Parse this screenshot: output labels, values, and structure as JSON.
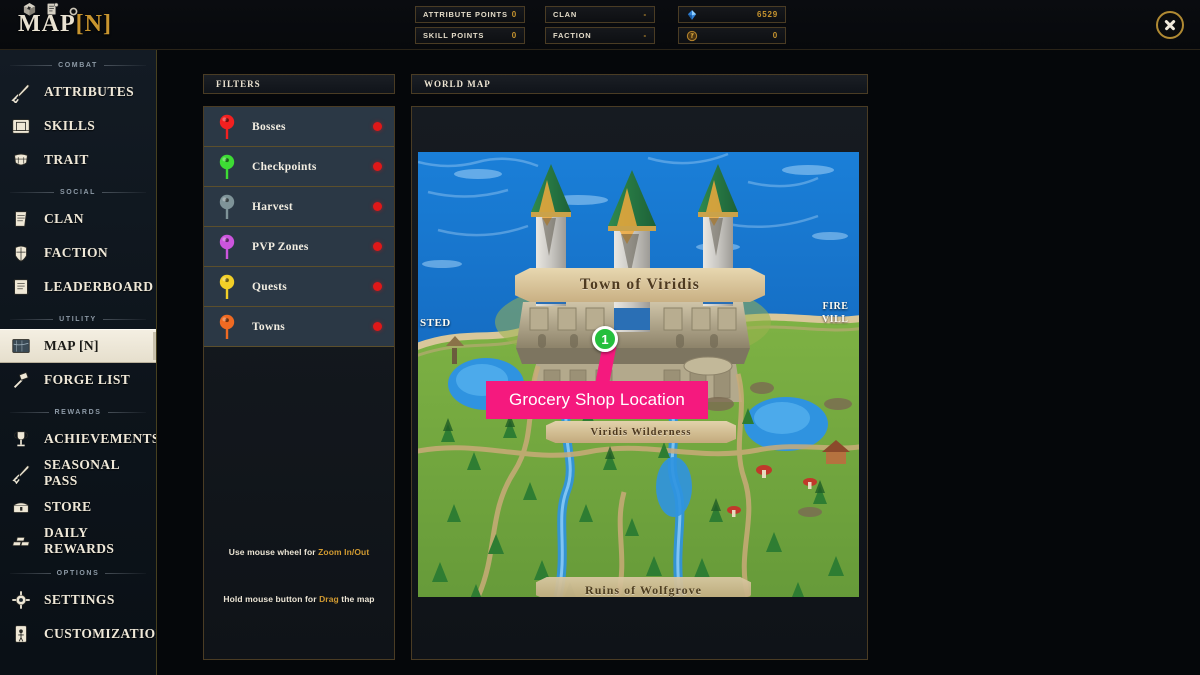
{
  "window": {
    "title": "MAP",
    "hotkey": "[N]",
    "close_label": "close"
  },
  "header": {
    "stats": [
      {
        "label": "ATTRIBUTE POINTS",
        "value": "0"
      },
      {
        "label": "SKILL POINTS",
        "value": "0"
      },
      {
        "label": "CLAN",
        "value": "-"
      },
      {
        "label": "FACTION",
        "value": "-"
      }
    ],
    "currencies": [
      {
        "icon": "gem-icon",
        "value": "6529",
        "color": "#2f7fd6"
      },
      {
        "icon": "coin-icon",
        "value": "0",
        "color": "#b3822c"
      }
    ]
  },
  "sidebar": {
    "sections": [
      {
        "title": "COMBAT",
        "items": [
          {
            "label": "ATTRIBUTES",
            "icon": "sword-icon",
            "active": false
          },
          {
            "label": "SKILLS",
            "icon": "book-icon",
            "active": false
          },
          {
            "label": "TRAIT",
            "icon": "armor-icon",
            "active": false
          }
        ]
      },
      {
        "title": "SOCIAL",
        "items": [
          {
            "label": "CLAN",
            "icon": "banner-icon",
            "active": false
          },
          {
            "label": "FACTION",
            "icon": "helmet-icon",
            "active": false
          },
          {
            "label": "LEADERBOARD",
            "icon": "scroll-icon",
            "active": false
          }
        ]
      },
      {
        "title": "UTILITY",
        "items": [
          {
            "label": "MAP [N]",
            "icon": "map-icon",
            "active": true
          },
          {
            "label": "FORGE LIST",
            "icon": "hammer-icon",
            "active": false
          }
        ]
      },
      {
        "title": "REWARDS",
        "items": [
          {
            "label": "ACHIEVEMENTS",
            "icon": "trophy-icon",
            "active": false
          },
          {
            "label": "SEASONAL PASS",
            "icon": "sword-pass-icon",
            "active": false
          },
          {
            "label": "STORE",
            "icon": "chest-icon",
            "active": false
          },
          {
            "label": "DAILY REWARDS",
            "icon": "gold-bars-icon",
            "active": false
          }
        ]
      },
      {
        "title": "OPTIONS",
        "items": [
          {
            "label": "SETTINGS",
            "icon": "gear-icon",
            "active": false
          },
          {
            "label": "CUSTOMIZATION",
            "icon": "character-card-icon",
            "active": false
          }
        ]
      }
    ]
  },
  "filters": {
    "panel_title": "FILTERS",
    "items": [
      {
        "label": "Bosses",
        "pin_color": "#f22020",
        "toggle_color": "#e01818"
      },
      {
        "label": "Checkpoints",
        "pin_color": "#3ddb34",
        "toggle_color": "#e01818"
      },
      {
        "label": "Harvest",
        "pin_color": "#7e9398",
        "toggle_color": "#e01818"
      },
      {
        "label": "PVP Zones",
        "pin_color": "#cc55dd",
        "toggle_color": "#e01818"
      },
      {
        "label": "Quests",
        "pin_color": "#f2cf27",
        "toggle_color": "#e01818"
      },
      {
        "label": "Towns",
        "pin_color": "#ef6a22",
        "toggle_color": "#e01818"
      }
    ],
    "hints": [
      {
        "prefix": "Use mouse wheel for ",
        "highlight": "Zoom In/Out",
        "suffix": ""
      },
      {
        "prefix": "Hold mouse button for ",
        "highlight": "Drag",
        "suffix": " the map"
      }
    ]
  },
  "map": {
    "panel_title": "WORLD MAP",
    "banners": {
      "town": "Town of Viridis",
      "wilderness": "Viridis Wilderness",
      "bottom": "Ruins of Wolfgrove"
    },
    "edge_labels": {
      "left": "STED",
      "right": "FIRE\nVILL"
    },
    "annotation": {
      "badge_number": "1",
      "tooltip_text": "Grocery Shop Location",
      "tooltip_color": "#f5197e",
      "badge_color": "#25bf3d"
    }
  }
}
